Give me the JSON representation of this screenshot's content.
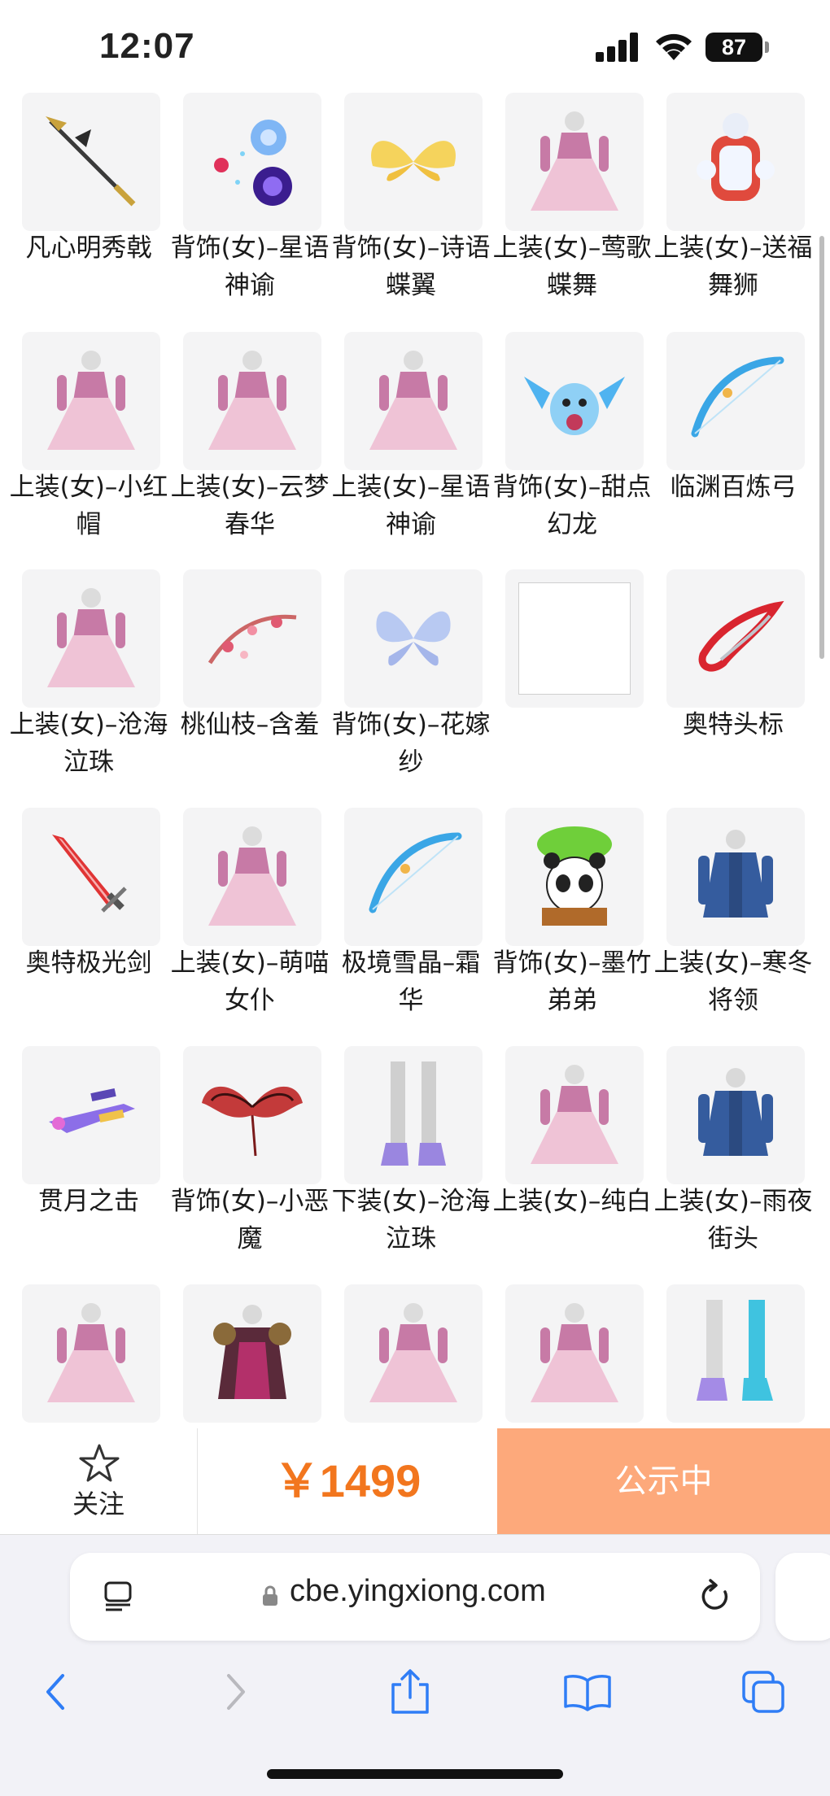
{
  "status_bar": {
    "time": "12:07",
    "battery": "87",
    "icons": [
      "signal-icon",
      "wifi-icon",
      "battery-icon"
    ]
  },
  "items": [
    {
      "name": "凡心明秀戟",
      "icon": "halberd-icon"
    },
    {
      "name": "背饰(女)–星语神谕",
      "icon": "star-orbs-icon"
    },
    {
      "name": "背饰(女)–诗语蝶翼",
      "icon": "butterfly-wings-icon"
    },
    {
      "name": "上装(女)–莺歌蝶舞",
      "icon": "costume-icon"
    },
    {
      "name": "上装(女)–送福舞狮",
      "icon": "lion-dance-costume-icon"
    },
    {
      "name": "上装(女)–小红帽",
      "icon": "dress-icon"
    },
    {
      "name": "上装(女)–云梦春华",
      "icon": "costume-icon"
    },
    {
      "name": "上装(女)–星语神谕",
      "icon": "costume-icon"
    },
    {
      "name": "背饰(女)–甜点幻龙",
      "icon": "dragon-pet-icon"
    },
    {
      "name": "临渊百炼弓",
      "icon": "bow-icon"
    },
    {
      "name": "上装(女)–沧海泣珠",
      "icon": "dress-icon"
    },
    {
      "name": "桃仙枝–含羞",
      "icon": "blossom-bow-icon"
    },
    {
      "name": "背饰(女)–花嫁纱",
      "icon": "fairy-wings-icon"
    },
    {
      "name": "",
      "icon": "empty-placeholder"
    },
    {
      "name": "奥特头标",
      "icon": "crest-icon"
    },
    {
      "name": "奥特极光剑",
      "icon": "sword-icon"
    },
    {
      "name": "上装(女)–萌喵女仆",
      "icon": "dress-icon"
    },
    {
      "name": "极境雪晶–霜华",
      "icon": "bow-icon"
    },
    {
      "name": "背饰(女)–墨竹弟弟",
      "icon": "panda-icon"
    },
    {
      "name": "上装(女)–寒冬将领",
      "icon": "coat-icon"
    },
    {
      "name": "贯月之击",
      "icon": "gun-icon"
    },
    {
      "name": "背饰(女)–小恶魔",
      "icon": "demon-wings-icon"
    },
    {
      "name": "下装(女)–沧海泣珠",
      "icon": "legs-icon"
    },
    {
      "name": "上装(女)–纯白",
      "icon": "dress-icon"
    },
    {
      "name": "上装(女)–雨夜街头",
      "icon": "coat-icon"
    },
    {
      "name": "",
      "icon": "dress-icon"
    },
    {
      "name": "",
      "icon": "armor-icon"
    },
    {
      "name": "",
      "icon": "dress-icon"
    },
    {
      "name": "",
      "icon": "dress-icon"
    },
    {
      "name": "",
      "icon": "boots-icon"
    }
  ],
  "action_bar": {
    "follow_label": "关注",
    "price": "￥1499",
    "status_button": "公示中",
    "accent_color": "#f2761e",
    "button_color": "#fda97b"
  },
  "browser": {
    "url": "cbe.yingxiong.com"
  }
}
